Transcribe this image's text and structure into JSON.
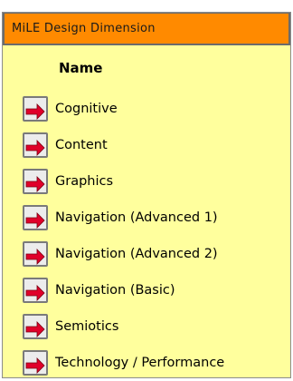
{
  "panel": {
    "title": "MiLE Design Dimension",
    "column_header": "Name",
    "colors": {
      "header_bg": "#ff8a00",
      "panel_bg": "#ffff9d",
      "icon_arrow": "#e0002a"
    },
    "items": [
      {
        "label": "Cognitive",
        "icon": "go-arrow-icon"
      },
      {
        "label": "Content",
        "icon": "go-arrow-icon"
      },
      {
        "label": "Graphics",
        "icon": "go-arrow-icon"
      },
      {
        "label": "Navigation (Advanced 1)",
        "icon": "go-arrow-icon"
      },
      {
        "label": "Navigation (Advanced 2)",
        "icon": "go-arrow-icon"
      },
      {
        "label": "Navigation (Basic)",
        "icon": "go-arrow-icon"
      },
      {
        "label": "Semiotics",
        "icon": "go-arrow-icon"
      },
      {
        "label": "Technology / Performance",
        "icon": "go-arrow-icon"
      }
    ]
  }
}
